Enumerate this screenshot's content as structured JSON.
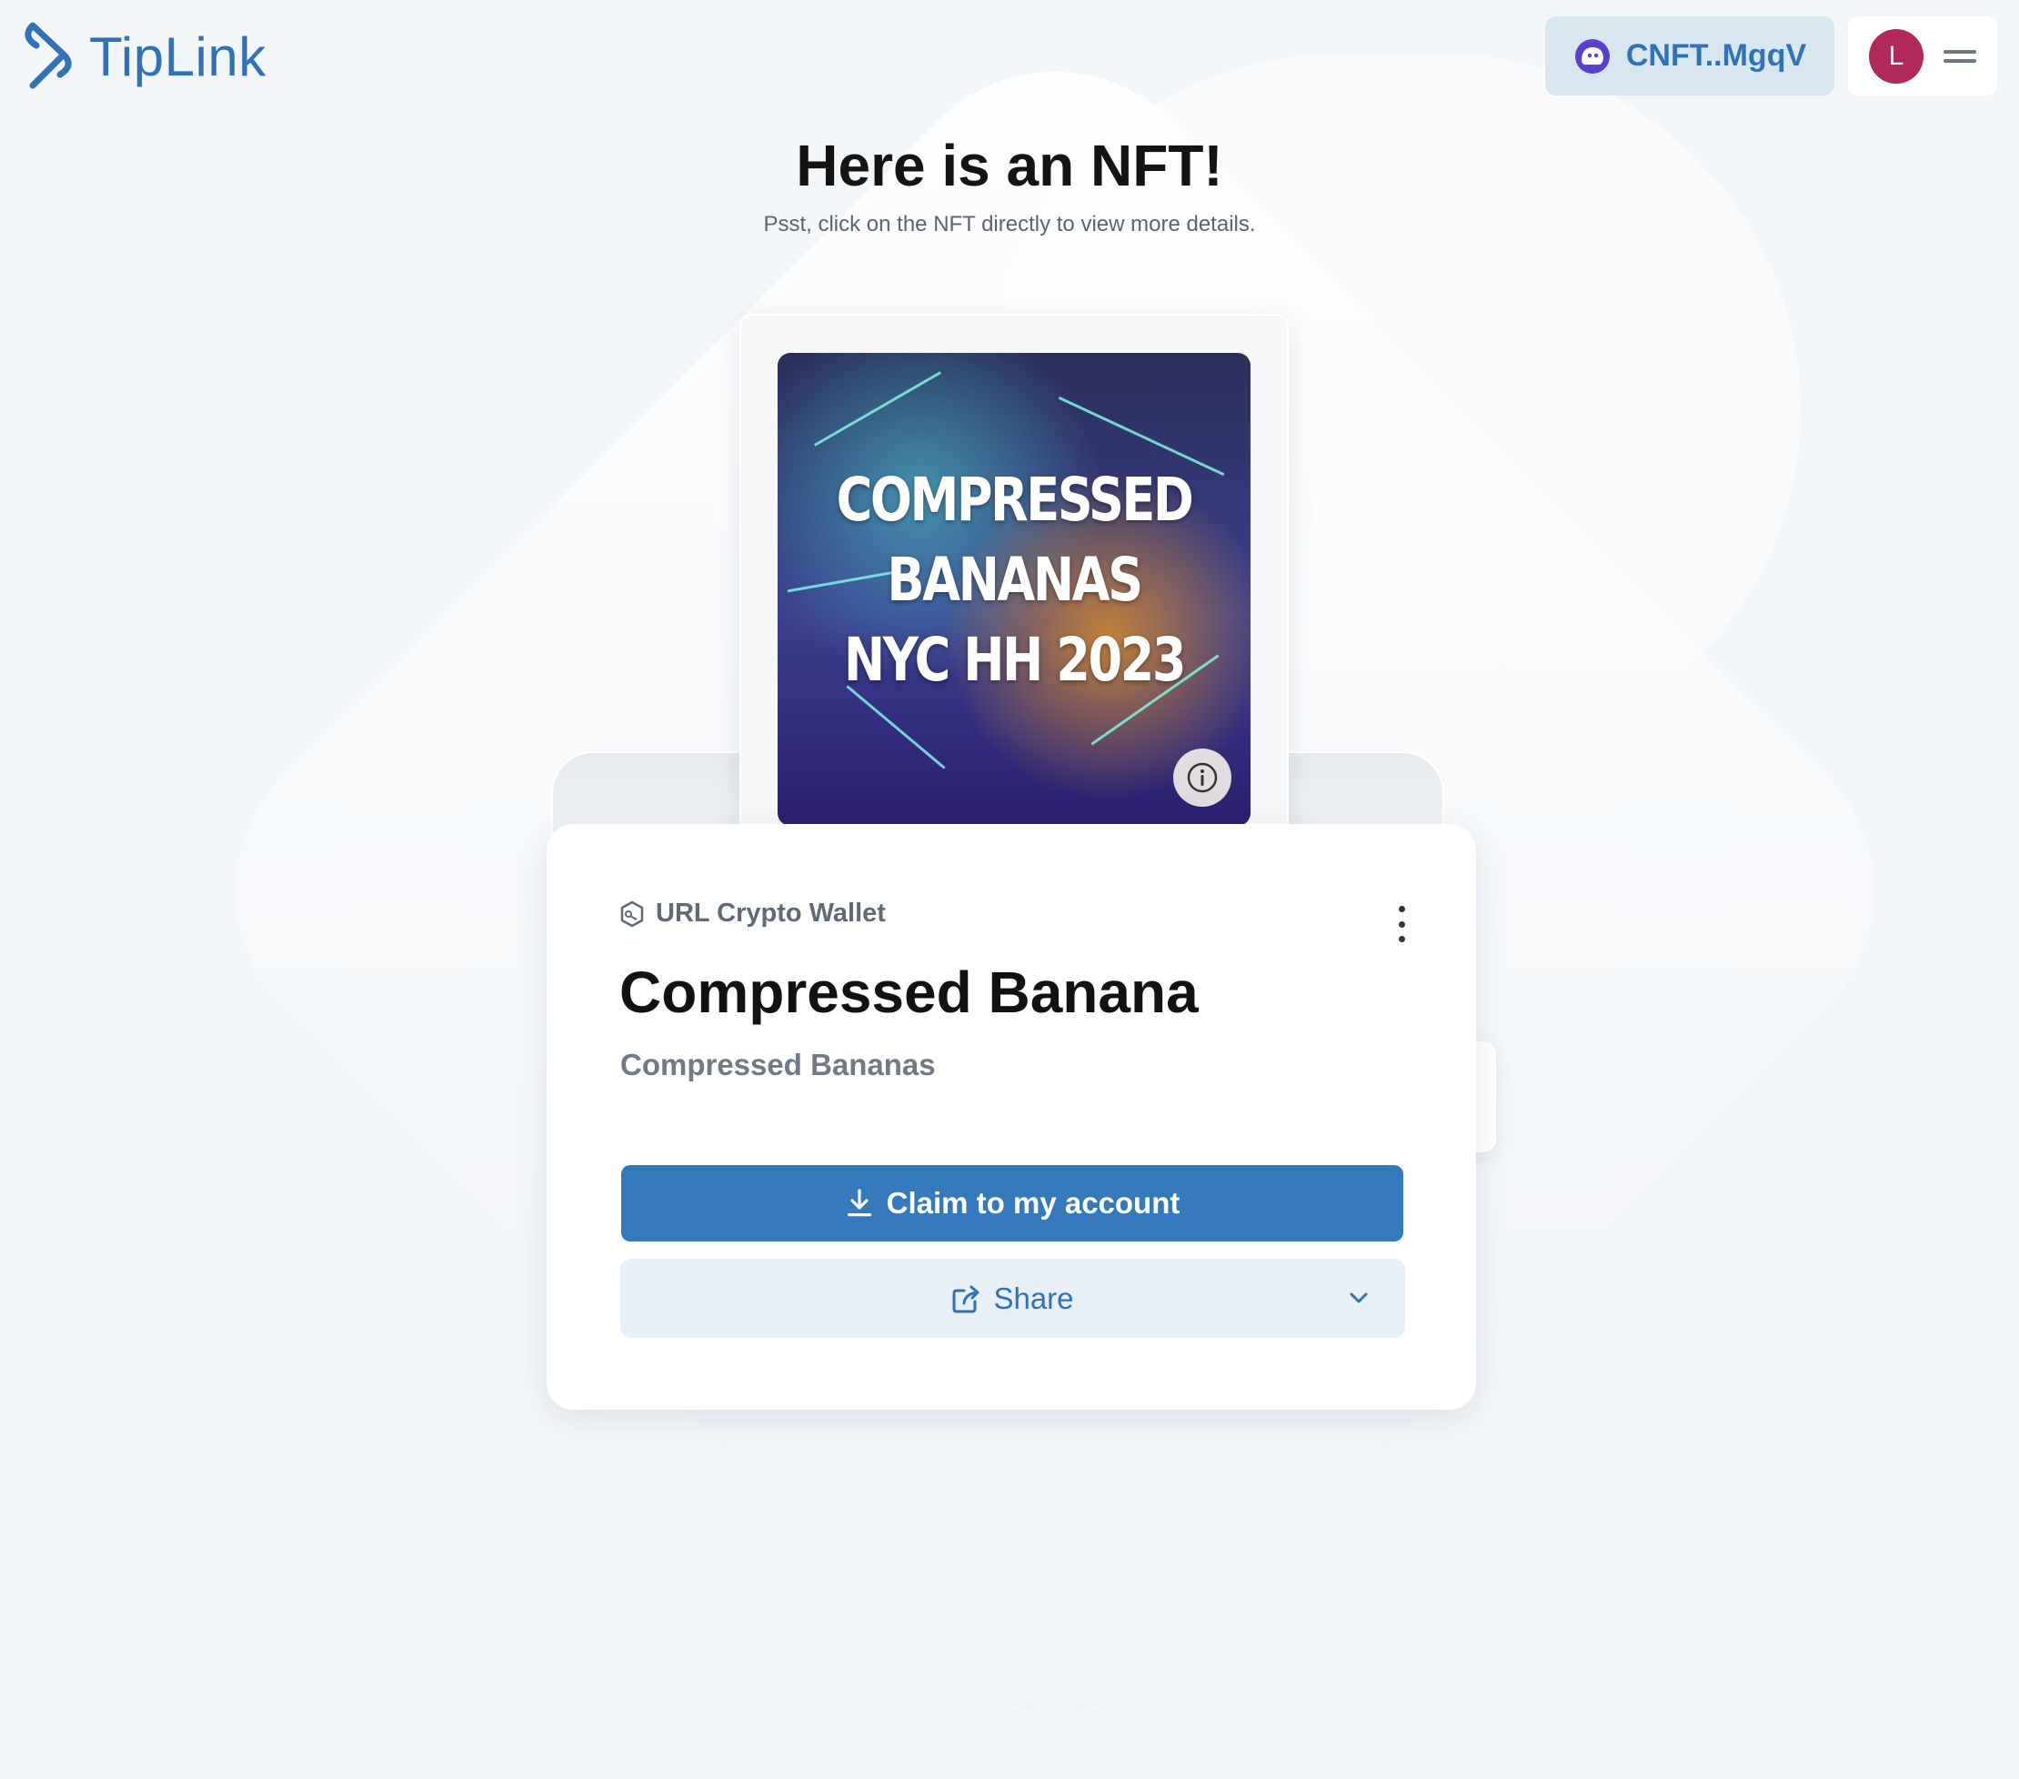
{
  "header": {
    "logo_text": "TipLink",
    "wallet_address": "CNFT..MgqV",
    "avatar_initial": "L"
  },
  "page": {
    "title": "Here is an NFT!",
    "subtitle": "Psst, click on the NFT directly to view more details."
  },
  "nft": {
    "image_text_lines": [
      "COMPRESSED",
      "BANANAS",
      "NYC HH 2023"
    ]
  },
  "card": {
    "label": "URL Crypto Wallet",
    "nft_name": "Compressed Banana",
    "collection_name": "Compressed Bananas",
    "claim_label": "Claim to my account",
    "share_label": "Share"
  },
  "colors": {
    "accent": "#3479bc",
    "link": "#2f72b8",
    "avatar_bg": "#b0295a",
    "wallet_pill_bg": "#d8e6f0",
    "share_bg": "#e8f0f7"
  },
  "icons": [
    "tiplink-logo-icon",
    "phantom-wallet-icon",
    "hamburger-menu-icon",
    "info-icon",
    "wallet-badge-icon",
    "more-vertical-icon",
    "key-icon",
    "download-icon",
    "share-external-icon",
    "chevron-down-icon"
  ]
}
